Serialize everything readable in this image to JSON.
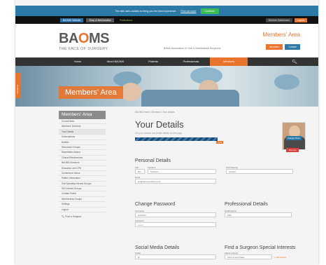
{
  "cookie": {
    "text": "This site uses cookies to bring you the best experience.",
    "link": "Find out more",
    "button": "Continue"
  },
  "topbar": {
    "left1": "BAOMS Website",
    "left2": "Shop & Merchandise",
    "pub": "Publications",
    "right1": "Member Dashboard",
    "right2": "Logout"
  },
  "header": {
    "logo_left": "BA",
    "logo_mark": "O",
    "logo_right": "MS",
    "tagline": "THE FACE OF SURGERY",
    "assoc": "British Association of Oral & Maxillofacial Surgeons",
    "members_area": "Members' Area",
    "btn1": "Members",
    "btn2": "Contact"
  },
  "nav": {
    "items": [
      "Home",
      "About BAOMS",
      "Patients",
      "Professionals",
      "Members"
    ],
    "active_index": 4
  },
  "hero": {
    "title": "Members' Area",
    "side_tab": "Feedback"
  },
  "sidebar": {
    "heading": "Members' Area",
    "items": [
      "Council Area",
      "Members' Directory",
      "Your Details",
      "Subscriptions",
      "Bulletin",
      "Discussion Groups",
      "Dissertation Award",
      "Clinical Effectiveness",
      "BAOMS Elections",
      "Education and CPD",
      "Conference videos",
      "Patient Information",
      "Sub Specialty Interest Groups",
      "SIG Interest Groups",
      "Contact Points",
      "Membership Groups",
      "Settings",
      "Logout"
    ],
    "active_index": 2,
    "footer": "Find a Surgeon"
  },
  "main": {
    "breadcrumb": "BAOMS Home  /  Members  /  Your Details",
    "title": "Your Details",
    "subtitle": "Set your contact and profile details on this page",
    "progress_badge": "74%",
    "progress": 0.74,
    "change_photo": "Change Photo",
    "remove": "Remove",
    "personal": {
      "heading": "Personal Details",
      "title_label": "Title",
      "title_value": "Mrs",
      "surname_label": "Surname",
      "surname_value": "Smithson",
      "first_label": "First Name(s)",
      "first_value": "Jennifer",
      "email_label": "Email",
      "email_value": "jen@baomsmember.co.uk"
    },
    "password": {
      "heading": "Change Password",
      "username_label": "Username",
      "username_value": "jsmithson",
      "password_label": "Password",
      "password_value": "••••••••"
    },
    "professional": {
      "heading": "Professional Details",
      "qual_label": "Qualifications",
      "qual_value": "FDS"
    },
    "social": {
      "heading": "Social Media Details",
      "twitter_label": "Twitter",
      "twitter_value": "@"
    },
    "surgeon": {
      "heading": "Find a Surgeon Special Interests",
      "interest_label": "Add an interest",
      "interest_value": "Cleft Lip and Palate",
      "add": "+ Add interest"
    }
  }
}
